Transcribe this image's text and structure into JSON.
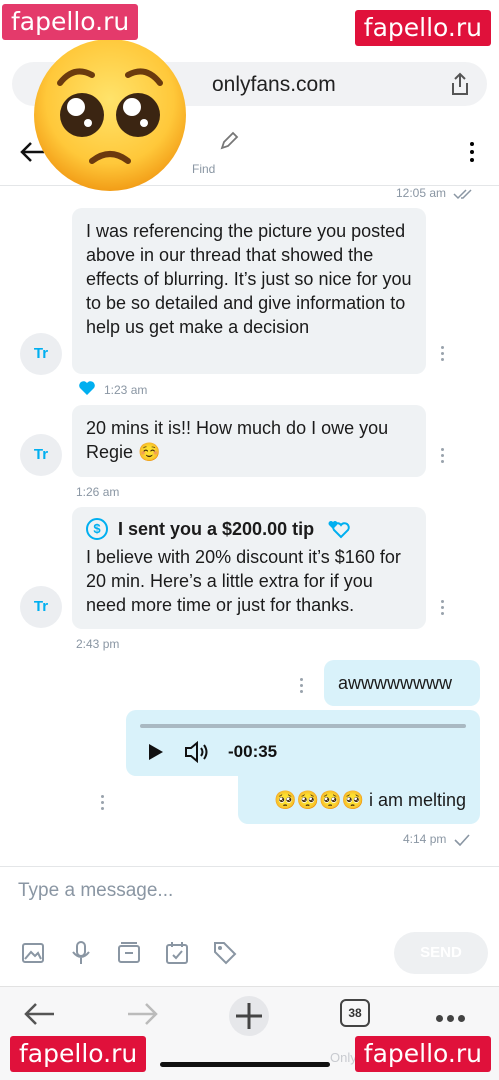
{
  "watermarks": [
    "fapello.ru",
    "fapello.ru",
    "fapello.ru",
    "fapello.ru"
  ],
  "browser": {
    "url": "onlyfans.com",
    "tab_count": "38",
    "footer_mark": "OnlyFans.com/rightregie"
  },
  "header": {
    "subtitle": "Find"
  },
  "messages": [
    {
      "time": "12:05 am",
      "text": "",
      "outgoing": true
    },
    {
      "sender": "Tr",
      "text": "I was referencing the picture you posted above in our thread that showed the effects of blurring. It’s just so nice for you to be so detailed and give information to help us get make a decision",
      "time": "1:23 am",
      "liked": true
    },
    {
      "sender": "Tr",
      "text": "20 mins it is!! How much do I owe you Regie ☺️",
      "time": "1:26 am"
    },
    {
      "sender": "Tr",
      "tip_label": "I sent you a $200.00 tip",
      "text": "I believe with 20% discount it’s $160 for 20 min. Here’s a little extra for if you need more time or just for thanks.",
      "time": "2:43 pm"
    },
    {
      "outgoing": true,
      "text": "awwwwwwww"
    },
    {
      "outgoing": true,
      "audio_time": "-00:35",
      "text": "🥺🥺🥺🥺 i am melting",
      "time": "4:14 pm"
    }
  ],
  "composer": {
    "placeholder": "Type a message...",
    "send_label": "SEND"
  },
  "colors": {
    "accent": "#00aff0",
    "incoming_bubble": "#eff2f4",
    "outgoing_bubble": "#d9f2fa"
  }
}
